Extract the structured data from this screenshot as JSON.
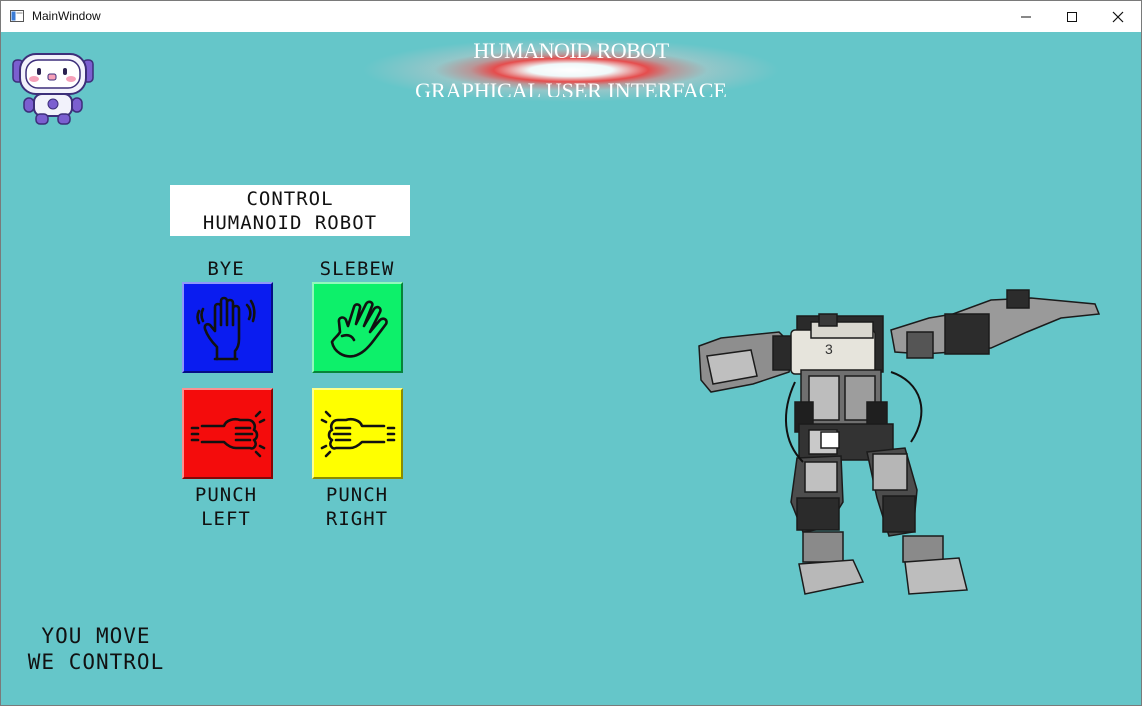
{
  "window": {
    "title": "MainWindow",
    "minimize_icon": "minimize-icon",
    "maximize_icon": "maximize-icon",
    "close_icon": "close-icon"
  },
  "header": {
    "title": "HUMANOID ROBOT",
    "subtitle": "GRAPHICAL USER INTERFACE",
    "logo_icon": "robot-mascot-icon"
  },
  "control_panel": {
    "heading_line1": "CONTROL",
    "heading_line2": "HUMANOID ROBOT",
    "buttons": [
      {
        "id": "bye",
        "label_line1": "BYE",
        "label_line2": "",
        "icon": "raised-hand-icon",
        "color": "#0a1cf0"
      },
      {
        "id": "slebew",
        "label_line1": "SLEBEW",
        "label_line2": "",
        "icon": "waving-hand-icon",
        "color": "#0df06a"
      },
      {
        "id": "punch_left",
        "label_line1": "PUNCH",
        "label_line2": "LEFT",
        "icon": "fist-punch-left-icon",
        "color": "#f40c0c"
      },
      {
        "id": "punch_right",
        "label_line1": "PUNCH",
        "label_line2": "RIGHT",
        "icon": "fist-punch-right-icon",
        "color": "#ffff00"
      }
    ]
  },
  "slogan": {
    "line1": "YOU MOVE",
    "line2": "WE CONTROL"
  },
  "colors": {
    "background": "#65c6c9",
    "titlebar": "#ffffff",
    "glow_red": "#ec4646"
  },
  "robot_photo": {
    "marker": "3"
  }
}
